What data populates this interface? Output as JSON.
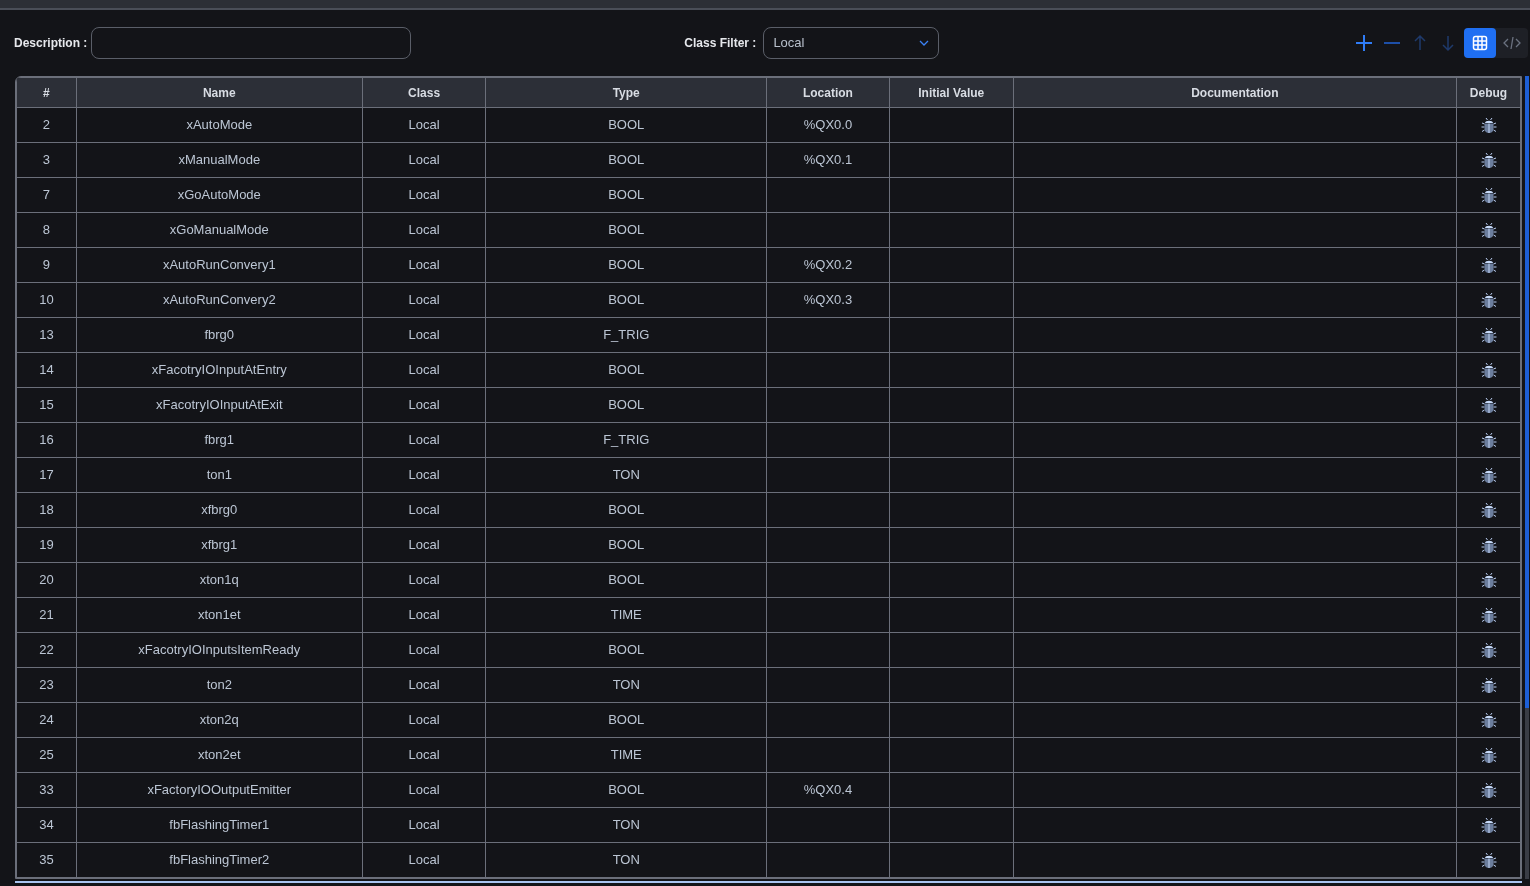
{
  "toolbar": {
    "description": {
      "label": "Description :"
    },
    "class_filter": {
      "label": "Class Filter :",
      "value": "Local"
    },
    "actions": [
      {
        "kind": "add",
        "disabled": false
      },
      {
        "kind": "remove",
        "disabled": false
      },
      {
        "kind": "up",
        "disabled": true
      },
      {
        "kind": "down",
        "disabled": true
      }
    ],
    "views": [
      {
        "kind": "table",
        "selected": true
      },
      {
        "kind": "code",
        "selected": false
      }
    ]
  },
  "table": {
    "columns": [
      "#",
      "Name",
      "Class",
      "Type",
      "Location",
      "Initial Value",
      "Documentation",
      "Debug"
    ],
    "rows": [
      {
        "index": "2",
        "name": "xAutoMode",
        "class": "Local",
        "type": "BOOL",
        "location": "%QX0.0"
      },
      {
        "index": "3",
        "name": "xManualMode",
        "class": "Local",
        "type": "BOOL",
        "location": "%QX0.1"
      },
      {
        "index": "7",
        "name": "xGoAutoMode",
        "class": "Local",
        "type": "BOOL"
      },
      {
        "index": "8",
        "name": "xGoManualMode",
        "class": "Local",
        "type": "BOOL"
      },
      {
        "index": "9",
        "name": "xAutoRunConvery1",
        "class": "Local",
        "type": "BOOL",
        "location": "%QX0.2"
      },
      {
        "index": "10",
        "name": "xAutoRunConvery2",
        "class": "Local",
        "type": "BOOL",
        "location": "%QX0.3"
      },
      {
        "index": "13",
        "name": "fbrg0",
        "class": "Local",
        "type": "F_TRIG"
      },
      {
        "index": "14",
        "name": "xFacotryIOInputAtEntry",
        "class": "Local",
        "type": "BOOL"
      },
      {
        "index": "15",
        "name": "xFacotryIOInputAtExit",
        "class": "Local",
        "type": "BOOL"
      },
      {
        "index": "16",
        "name": "fbrg1",
        "class": "Local",
        "type": "F_TRIG"
      },
      {
        "index": "17",
        "name": "ton1",
        "class": "Local",
        "type": "TON"
      },
      {
        "index": "18",
        "name": "xfbrg0",
        "class": "Local",
        "type": "BOOL"
      },
      {
        "index": "19",
        "name": "xfbrg1",
        "class": "Local",
        "type": "BOOL"
      },
      {
        "index": "20",
        "name": "xton1q",
        "class": "Local",
        "type": "BOOL"
      },
      {
        "index": "21",
        "name": "xton1et",
        "class": "Local",
        "type": "TIME"
      },
      {
        "index": "22",
        "name": "xFacotryIOInputsItemReady",
        "class": "Local",
        "type": "BOOL"
      },
      {
        "index": "23",
        "name": "ton2",
        "class": "Local",
        "type": "TON"
      },
      {
        "index": "24",
        "name": "xton2q",
        "class": "Local",
        "type": "BOOL"
      },
      {
        "index": "25",
        "name": "xton2et",
        "class": "Local",
        "type": "TIME"
      },
      {
        "index": "33",
        "name": "xFactoryIOOutputEmitter",
        "class": "Local",
        "type": "BOOL",
        "location": "%QX0.4"
      },
      {
        "index": "34",
        "name": "fbFlashingTimer1",
        "class": "Local",
        "type": "TON"
      },
      {
        "index": "35",
        "name": "fbFlashingTimer2",
        "class": "Local",
        "type": "TON"
      }
    ]
  }
}
